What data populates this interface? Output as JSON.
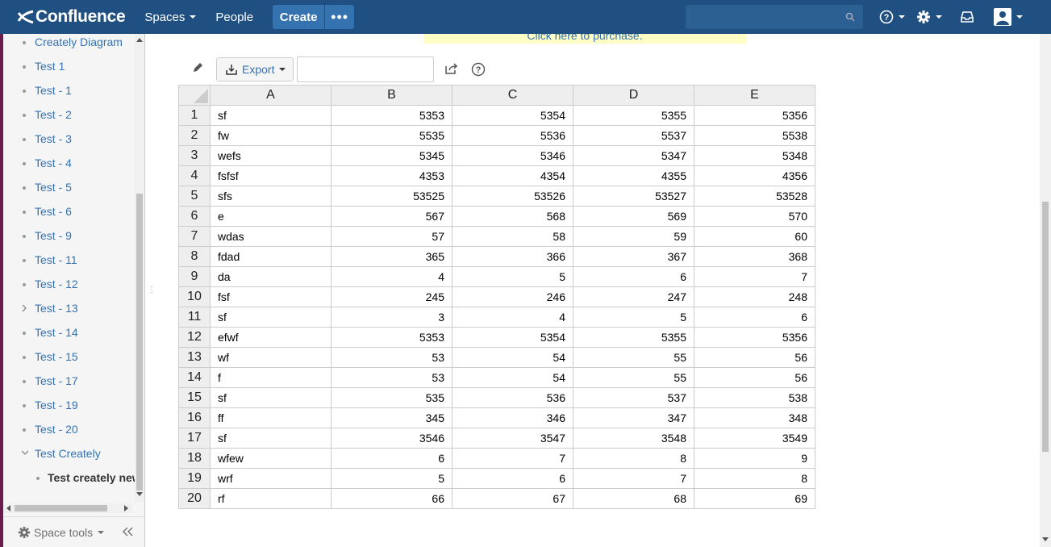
{
  "nav": {
    "logo": "Confluence",
    "spaces": "Spaces",
    "people": "People",
    "create": "Create",
    "more": "•••"
  },
  "sidebar": {
    "items": [
      {
        "label": "Creately Diagram"
      },
      {
        "label": "Test 1"
      },
      {
        "label": "Test - 1"
      },
      {
        "label": "Test - 2"
      },
      {
        "label": "Test - 3"
      },
      {
        "label": "Test - 4"
      },
      {
        "label": "Test - 5"
      },
      {
        "label": "Test - 6"
      },
      {
        "label": "Test - 9"
      },
      {
        "label": "Test - 11"
      },
      {
        "label": "Test - 12"
      },
      {
        "label": "Test - 13"
      },
      {
        "label": "Test - 14"
      },
      {
        "label": "Test - 15"
      },
      {
        "label": "Test - 17"
      },
      {
        "label": "Test - 19"
      },
      {
        "label": "Test - 20"
      },
      {
        "label": "Test Creately"
      },
      {
        "label": "Test creately new"
      }
    ],
    "space_tools": "Space tools"
  },
  "banner": "Click here to purchase.",
  "toolbar": {
    "export": "Export"
  },
  "table": {
    "columns": [
      "A",
      "B",
      "C",
      "D",
      "E"
    ],
    "rows": [
      [
        "1",
        "sf",
        "5353",
        "5354",
        "5355",
        "5356"
      ],
      [
        "2",
        "fw",
        "5535",
        "5536",
        "5537",
        "5538"
      ],
      [
        "3",
        "wefs",
        "5345",
        "5346",
        "5347",
        "5348"
      ],
      [
        "4",
        "fsfsf",
        "4353",
        "4354",
        "4355",
        "4356"
      ],
      [
        "5",
        "sfs",
        "53525",
        "53526",
        "53527",
        "53528"
      ],
      [
        "6",
        "e",
        "567",
        "568",
        "569",
        "570"
      ],
      [
        "7",
        "wdas",
        "57",
        "58",
        "59",
        "60"
      ],
      [
        "8",
        "fdad",
        "365",
        "366",
        "367",
        "368"
      ],
      [
        "9",
        "da",
        "4",
        "5",
        "6",
        "7"
      ],
      [
        "10",
        "fsf",
        "245",
        "246",
        "247",
        "248"
      ],
      [
        "11",
        "sf",
        "3",
        "4",
        "5",
        "6"
      ],
      [
        "12",
        "efwf",
        "5353",
        "5354",
        "5355",
        "5356"
      ],
      [
        "13",
        "wf",
        "53",
        "54",
        "55",
        "56"
      ],
      [
        "14",
        "f",
        "53",
        "54",
        "55",
        "56"
      ],
      [
        "15",
        "sf",
        "535",
        "536",
        "537",
        "538"
      ],
      [
        "16",
        "ff",
        "345",
        "346",
        "347",
        "348"
      ],
      [
        "17",
        "sf",
        "3546",
        "3547",
        "3548",
        "3549"
      ],
      [
        "18",
        "wfew",
        "6",
        "7",
        "8",
        "9"
      ],
      [
        "19",
        "wrf",
        "5",
        "6",
        "7",
        "8"
      ],
      [
        "20",
        "rf",
        "66",
        "67",
        "68",
        "69"
      ]
    ]
  },
  "icons": {
    "search": "search-icon",
    "help": "help-icon",
    "settings": "gear-icon",
    "notifications": "inbox-icon",
    "user": "avatar-icon"
  },
  "colors": {
    "header": "#205081",
    "link": "#3572b0",
    "banner": "#ffffc6"
  }
}
